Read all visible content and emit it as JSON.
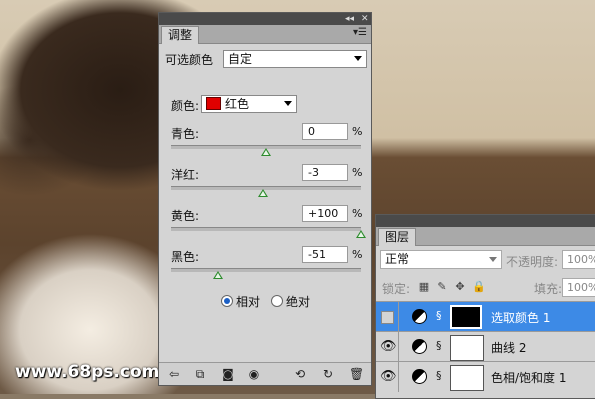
{
  "watermark": "www.68ps.com",
  "adjustments": {
    "tab": "调整",
    "preset_label": "可选颜色",
    "preset_value": "自定",
    "colors_label": "颜色:",
    "colors_value": "红色",
    "colors_swatch": "#e00000",
    "sliders": [
      {
        "label": "青色:",
        "value": "0",
        "unit": "%",
        "fraction": 0.5
      },
      {
        "label": "洋红:",
        "value": "-3",
        "unit": "%",
        "fraction": 0.485
      },
      {
        "label": "黄色:",
        "value": "+100",
        "unit": "%",
        "fraction": 1.0
      },
      {
        "label": "黑色:",
        "value": "-51",
        "unit": "%",
        "fraction": 0.245
      }
    ],
    "method_relative": "相对",
    "method_absolute": "绝对",
    "method_selected": "relative"
  },
  "layers": {
    "tab": "图层",
    "blend_mode": "正常",
    "opacity_label": "不透明度:",
    "opacity_value": "100%",
    "lock_label": "锁定:",
    "fill_label": "填充:",
    "fill_value": "100%",
    "rows": [
      {
        "name": "选取颜色 1",
        "selected": true,
        "visible": false,
        "mask": "black"
      },
      {
        "name": "曲线 2",
        "selected": false,
        "visible": true,
        "mask": "white"
      },
      {
        "name": "色相/饱和度 1",
        "selected": false,
        "visible": true,
        "mask": "white"
      }
    ]
  },
  "colors": {
    "selection": "#3d8ae6",
    "panel": "#d4d4d4",
    "slider_thumb": "#2e8b2e"
  }
}
